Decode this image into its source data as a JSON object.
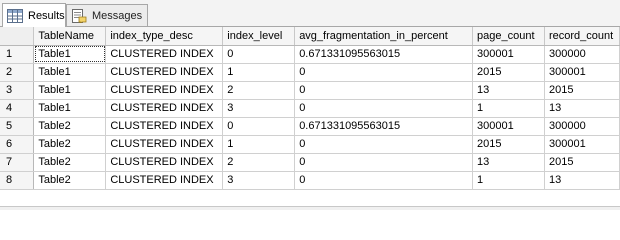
{
  "tabs": [
    {
      "label": "Results",
      "icon": "grid-icon",
      "active": true
    },
    {
      "label": "Messages",
      "icon": "messages-icon",
      "active": false
    }
  ],
  "grid": {
    "columns": [
      "TableName",
      "index_type_desc",
      "index_level",
      "avg_fragmentation_in_percent",
      "page_count",
      "record_count"
    ],
    "rows": [
      {
        "num": "1",
        "cells": [
          "Table1",
          "CLUSTERED INDEX",
          "0",
          "0.671331095563015",
          "300001",
          "300000"
        ]
      },
      {
        "num": "2",
        "cells": [
          "Table1",
          "CLUSTERED INDEX",
          "1",
          "0",
          "2015",
          "300001"
        ]
      },
      {
        "num": "3",
        "cells": [
          "Table1",
          "CLUSTERED INDEX",
          "2",
          "0",
          "13",
          "2015"
        ]
      },
      {
        "num": "4",
        "cells": [
          "Table1",
          "CLUSTERED INDEX",
          "3",
          "0",
          "1",
          "13"
        ]
      },
      {
        "num": "5",
        "cells": [
          "Table2",
          "CLUSTERED INDEX",
          "0",
          "0.671331095563015",
          "300001",
          "300000"
        ]
      },
      {
        "num": "6",
        "cells": [
          "Table2",
          "CLUSTERED INDEX",
          "1",
          "0",
          "2015",
          "300001"
        ]
      },
      {
        "num": "7",
        "cells": [
          "Table2",
          "CLUSTERED INDEX",
          "2",
          "0",
          "13",
          "2015"
        ]
      },
      {
        "num": "8",
        "cells": [
          "Table2",
          "CLUSTERED INDEX",
          "3",
          "0",
          "1",
          "13"
        ]
      }
    ]
  }
}
